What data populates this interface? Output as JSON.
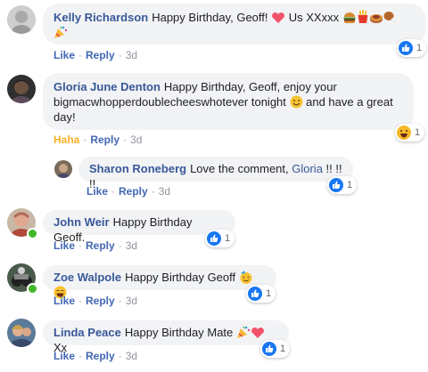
{
  "comments": [
    {
      "author": "Kelly Richardson",
      "text": "Happy Birthday, Geoff! ",
      "text2": " Us XXxxx ",
      "like": "Like",
      "reply": "Reply",
      "time": "3d",
      "reactions": "1"
    },
    {
      "author": "Gloria June Denton",
      "text": "Happy Birthday, Geoff, enjoy your bigmacwhopperdoublecheeswhotever tonight ",
      "text2": " and have a great day!",
      "like": "Haha",
      "reply": "Reply",
      "time": "3d",
      "reactions": "1"
    },
    {
      "author": "Sharon Roneberg",
      "text": "Love the comment, ",
      "mention": "Gloria",
      "text2": " !! !! !!",
      "like": "Like",
      "reply": "Reply",
      "time": "3d",
      "reactions": "1"
    },
    {
      "author": "John Weir",
      "text": "Happy Birthday Geoff.",
      "like": "Like",
      "reply": "Reply",
      "time": "3d",
      "reactions": "1"
    },
    {
      "author": "Zoe Walpole",
      "text": "Happy Birthday Geoff ",
      "like": "Like",
      "reply": "Reply",
      "time": "3d",
      "reactions": "1"
    },
    {
      "author": "Linda Peace",
      "text": "Happy Birthday Mate ",
      "text2": "Xx",
      "like": "Like",
      "reply": "Reply",
      "time": "3d",
      "reactions": "1"
    }
  ],
  "separator": "·",
  "colors": {
    "link": "#385898",
    "action": "#4267b2",
    "haha": "#f7b125",
    "like_blue": "#1877f2",
    "bubble": "#f2f3f5"
  }
}
